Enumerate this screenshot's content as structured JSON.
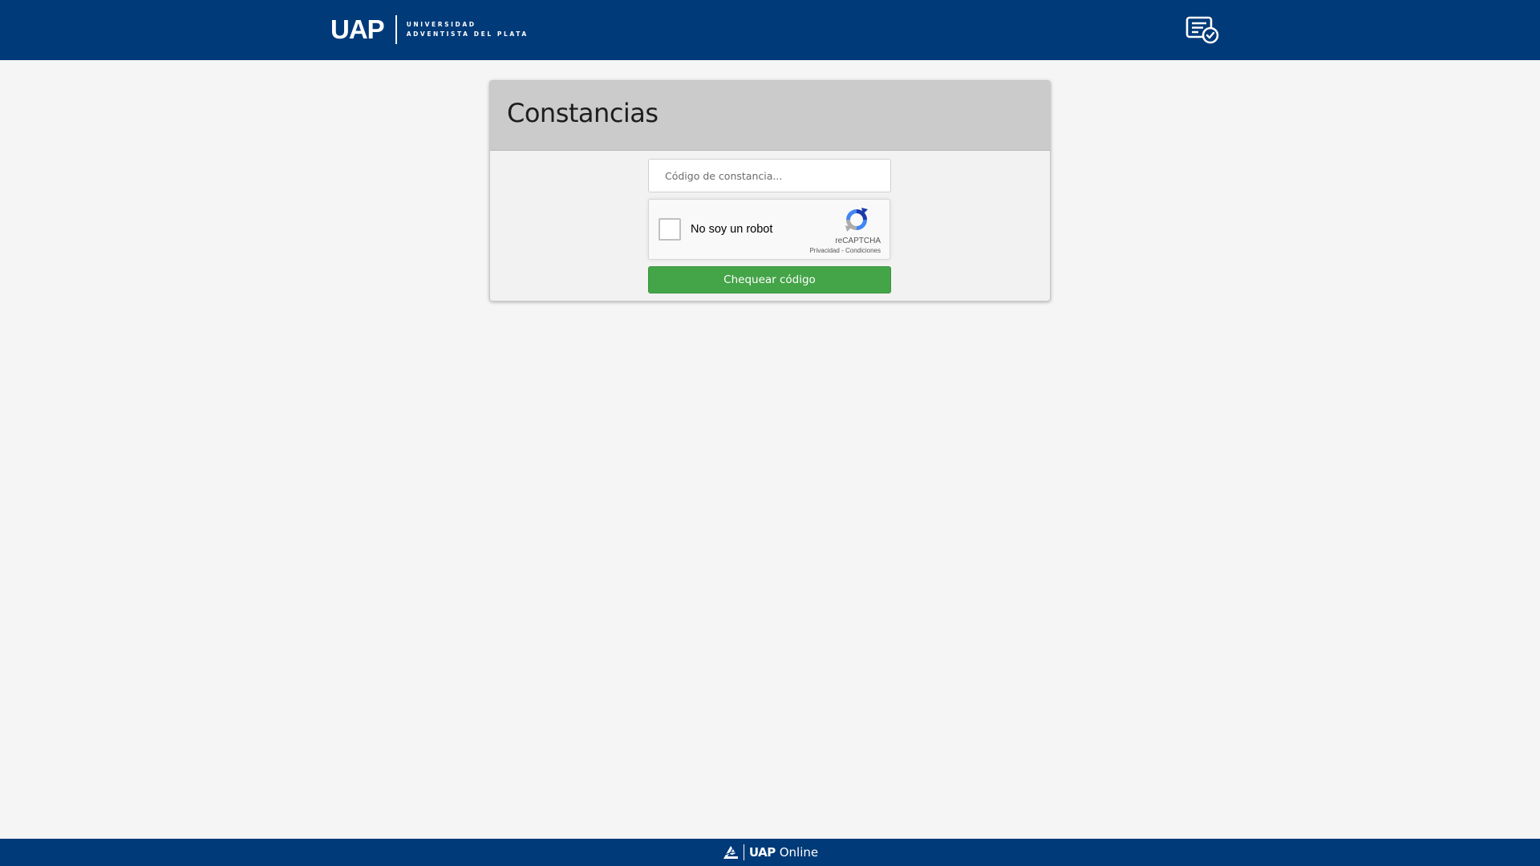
{
  "header": {
    "logo_mark": "UAP",
    "logo_line1": "UNIVERSIDAD",
    "logo_line2": "ADVENTISTA DEL PLATA",
    "cert_icon": "certificate-verify-icon"
  },
  "card": {
    "title": "Constancias",
    "code_placeholder": "Código de constancia...",
    "code_value": "",
    "captcha": {
      "label": "No soy un robot",
      "brand": "reCAPTCHA",
      "privacy": "Privacidad",
      "separator": "-",
      "terms": "Condiciones",
      "icon": "recaptcha-logo-icon"
    },
    "submit_label": "Chequear código"
  },
  "footer": {
    "brand": "UAP",
    "product": "Online",
    "icon": "adventist-flame-icon"
  },
  "colors": {
    "header_bg": "#003a78",
    "page_bg": "#f5f5f5",
    "card_head_bg": "#cbcbcb",
    "button_bg": "#44a448"
  }
}
